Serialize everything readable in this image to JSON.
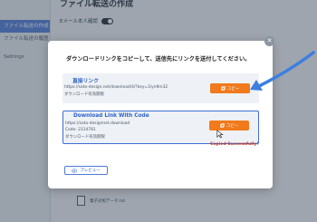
{
  "background": {
    "page_title": "ファイル転送の作成",
    "toggle_label": "Eメール本人確認",
    "sidebar_items": [
      "ファイル転送の作成",
      "ファイル転送の履歴",
      "Settings"
    ],
    "file_name": "電子対照データ.txt"
  },
  "modal": {
    "heading": "ダウンロードリンクをコピーして、送信先にリンクを送付してください。",
    "close_icon": "close-icon",
    "cards": [
      {
        "title": "直接リンク",
        "lines": [
          "https://sato-design.net/download/4/?key=1lyn9m32",
          "ダウンロード有効期限"
        ],
        "button": "コピー"
      },
      {
        "title": "Download Link With Code",
        "lines": [
          "https://sato-designnet.download",
          "Code: 2314781",
          "ダウンロード有効期限"
        ],
        "button": "コピー"
      }
    ],
    "status": "Copied Successfully!",
    "preview_button": "プレビュー"
  },
  "colors": {
    "accent_blue": "#2f63c9",
    "copy_orange": "#f07a1c",
    "status_red": "#c0392b",
    "arrow_blue": "#3d7fe0"
  }
}
